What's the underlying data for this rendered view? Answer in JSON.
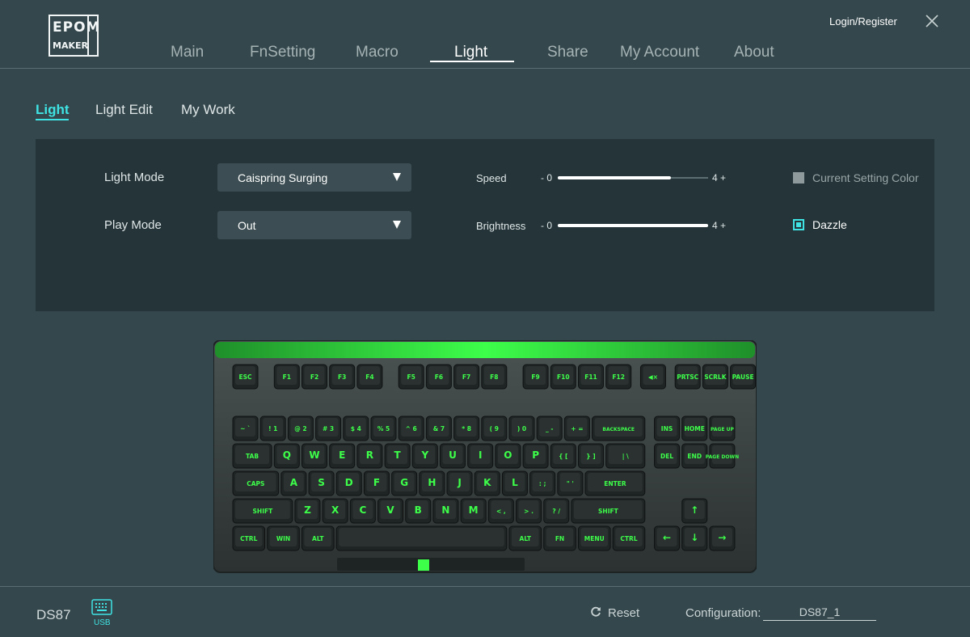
{
  "header": {
    "logo_line1": "EPOM",
    "logo_line2": "MAKER",
    "nav": [
      {
        "label": "Main"
      },
      {
        "label": "FnSetting"
      },
      {
        "label": "Macro"
      },
      {
        "label": "Light"
      },
      {
        "label": "Share"
      },
      {
        "label": "My Account"
      },
      {
        "label": "About"
      }
    ],
    "active_nav": "Light",
    "login_label": "Login/Register",
    "close_icon": "close-icon"
  },
  "subtabs": [
    {
      "label": "Light"
    },
    {
      "label": "Light Edit"
    },
    {
      "label": "My Work"
    }
  ],
  "active_subtab": "Light",
  "panel": {
    "light_mode_label": "Light Mode",
    "light_mode_value": "Caispring Surging",
    "play_mode_label": "Play Mode",
    "play_mode_value": "Out",
    "speed_label": "Speed",
    "speed_min": "- 0",
    "speed_max": "4 +",
    "speed_value": 3,
    "brightness_label": "Brightness",
    "brightness_min": "- 0",
    "brightness_max": "4 +",
    "brightness_value": 4,
    "current_color_label": "Current Setting Color",
    "current_color_checked": false,
    "dazzle_label": "Dazzle",
    "dazzle_checked": true
  },
  "keyboard": {
    "rows": [
      [
        "ESC",
        "F1",
        "F2",
        "F3",
        "F4",
        "F5",
        "F6",
        "F7",
        "F8",
        "F9",
        "F10",
        "F11",
        "F12",
        "◀×",
        "PRTSC",
        "SCRLK",
        "PAUSE"
      ],
      [
        "~ `",
        "! 1",
        "@ 2",
        "# 3",
        "$ 4",
        "% 5",
        "^ 6",
        "& 7",
        "* 8",
        "( 9",
        ") 0",
        "_ -",
        "+ =",
        "BACKSPACE",
        "INS",
        "HOME",
        "PAGE UP"
      ],
      [
        "TAB",
        "Q",
        "W",
        "E",
        "R",
        "T",
        "Y",
        "U",
        "I",
        "O",
        "P",
        "{ [",
        "} ]",
        "| \\",
        "DEL",
        "END",
        "PAGE DOWN"
      ],
      [
        "CAPS",
        "A",
        "S",
        "D",
        "F",
        "G",
        "H",
        "J",
        "K",
        "L",
        ": ;",
        "\" '",
        "ENTER"
      ],
      [
        "SHIFT",
        "Z",
        "X",
        "C",
        "V",
        "B",
        "N",
        "M",
        "< ,",
        "> .",
        "? /",
        "SHIFT",
        "↑"
      ],
      [
        "CTRL",
        "WIN",
        "ALT",
        "",
        "ALT",
        "FN",
        "MENU",
        "CTRL",
        "←",
        "↓",
        "→"
      ]
    ]
  },
  "footer": {
    "model": "DS87",
    "usb_label": "USB",
    "reset_label": "Reset",
    "config_label": "Configuration:",
    "config_value": "DS87_1"
  },
  "colors": {
    "accent": "#3fe3e3",
    "background": "#34474c",
    "panel": "#243438",
    "key_glow": "#3dff4a"
  }
}
